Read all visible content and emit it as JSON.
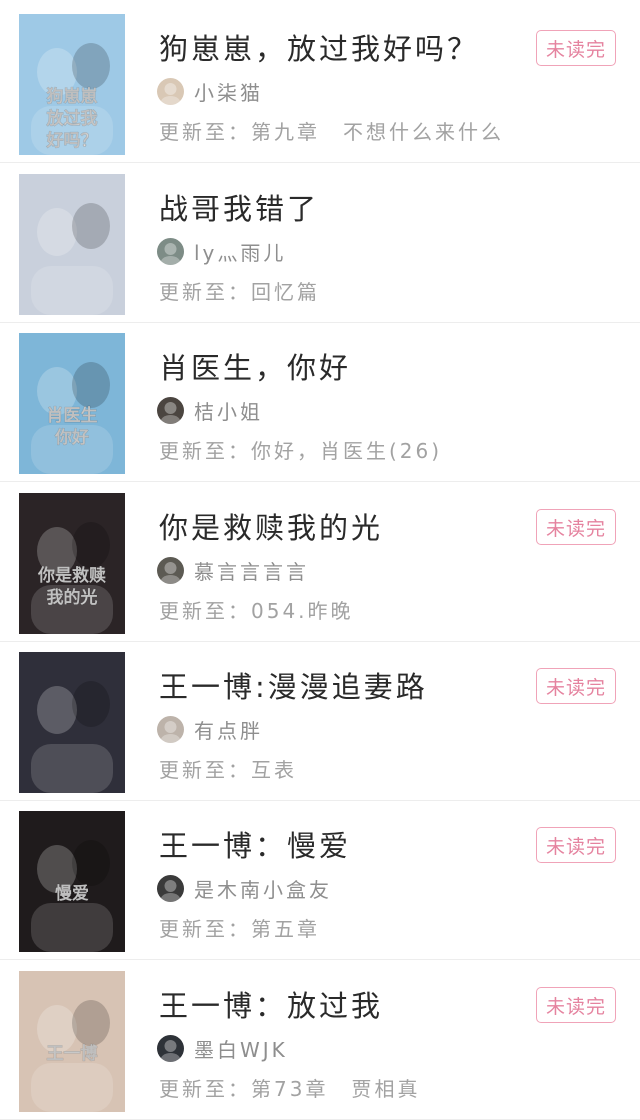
{
  "books": [
    {
      "title": "狗崽崽，放过我好吗？",
      "author": "小柒猫",
      "update_prefix": "更新至：",
      "update_chapter": "第九章　不想什么来什么",
      "badge": "未读完",
      "cover_text": [
        "狗崽崽",
        "放过我",
        "好吗？"
      ],
      "cover_color": "#9ec9e6",
      "avatar_color": "#d9c8b5"
    },
    {
      "title": "战哥我错了",
      "author": "ly灬雨儿",
      "update_prefix": "更新至：",
      "update_chapter": "回忆篇",
      "badge": "",
      "cover_text": [],
      "cover_color": "#c9d0dc",
      "avatar_color": "#7d8c86"
    },
    {
      "title": "肖医生，你好",
      "author": "桔小姐",
      "update_prefix": "更新至：",
      "update_chapter": "你好，肖医生(26)",
      "badge": "",
      "cover_text": [
        "肖医生",
        "你好"
      ],
      "cover_color": "#7eb6d8",
      "avatar_color": "#4b4540"
    },
    {
      "title": "你是救赎我的光",
      "author": "慕言言言言",
      "update_prefix": "更新至：",
      "update_chapter": "054.昨晚",
      "badge": "未读完",
      "cover_text": [
        "你是救赎",
        "我的光"
      ],
      "cover_color": "#2b2426",
      "avatar_color": "#5c5a53"
    },
    {
      "title": "王一博:漫漫追妻路",
      "author": "有点胖",
      "update_prefix": "更新至：",
      "update_chapter": "互表",
      "badge": "未读完",
      "cover_text": [],
      "cover_color": "#2f2f3a",
      "avatar_color": "#bdb3aa"
    },
    {
      "title": "王一博：慢爱",
      "author": "是木南小盒友",
      "update_prefix": "更新至：",
      "update_chapter": "第五章",
      "badge": "未读完",
      "cover_text": [
        "慢爱"
      ],
      "cover_color": "#1f1b1c",
      "avatar_color": "#3a3a3a"
    },
    {
      "title": "王一博：放过我",
      "author": "墨白WJK",
      "update_prefix": "更新至：",
      "update_chapter": "第73章　贾相真",
      "badge": "未读完",
      "cover_text": [
        "王一博"
      ],
      "cover_color": "#d7c3b4",
      "avatar_color": "#2e3238"
    }
  ]
}
